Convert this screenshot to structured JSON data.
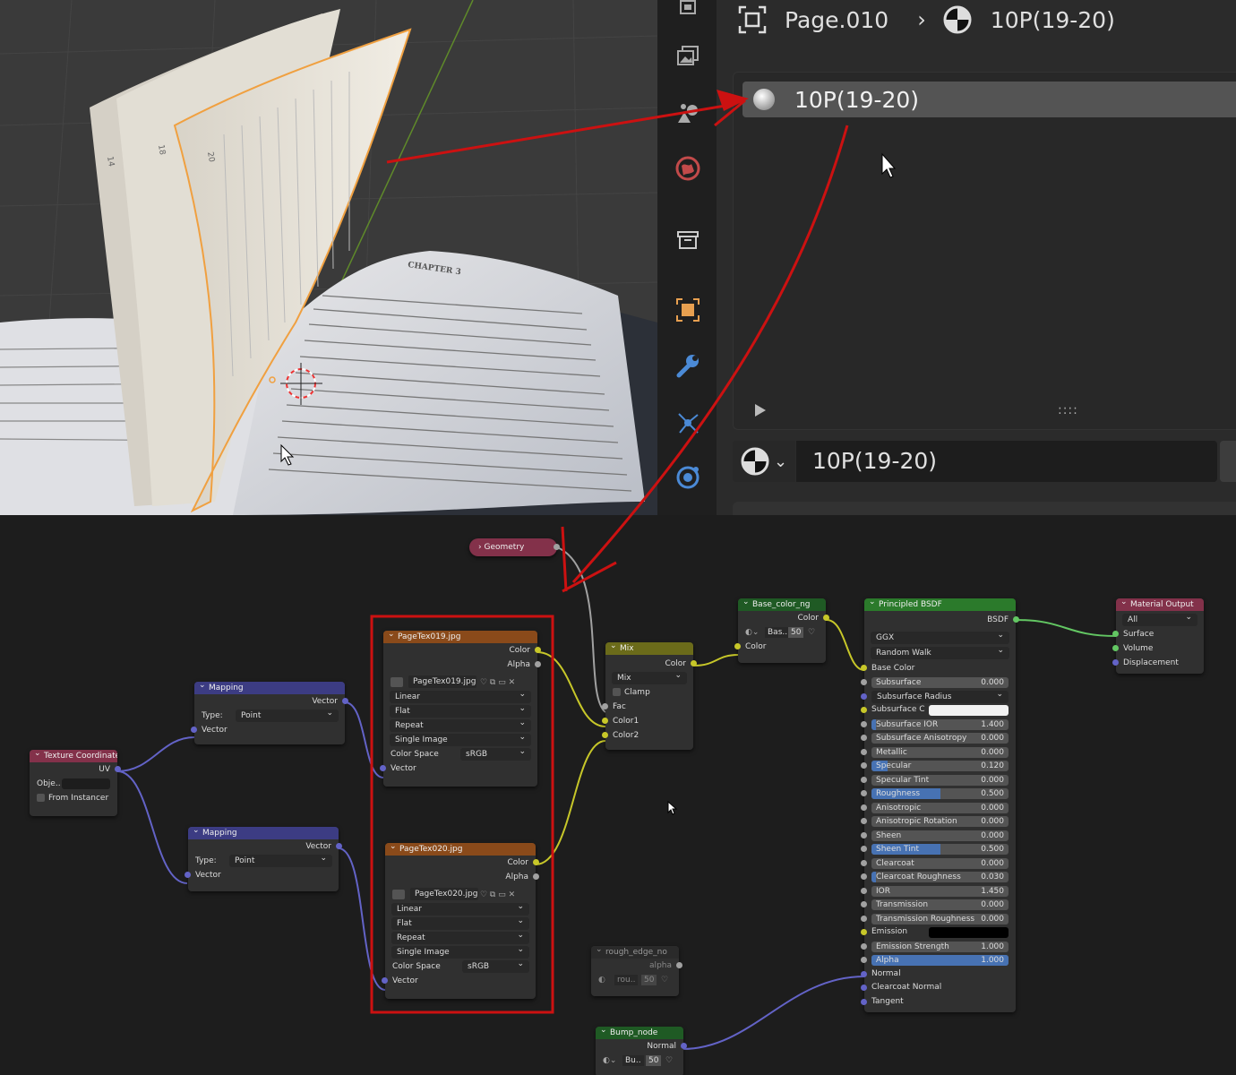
{
  "viewport": {
    "chapter_heading": "CHAPTER 3",
    "page_numbers": [
      "14",
      "18",
      "20"
    ]
  },
  "properties": {
    "breadcrumb": {
      "object": "Page.010",
      "material": "10P(19-20)"
    },
    "material_slot": "10P(19-20)",
    "material_selector": "10P(19-20)"
  },
  "sidebar_tabs": [
    "render-icon",
    "output-icon",
    "view-layer-icon",
    "scene-icon",
    "world-icon",
    "collection-icon",
    "object-icon",
    "modifier-icon",
    "particles-icon",
    "physics-icon"
  ],
  "nodes": {
    "geometry": {
      "title": "Geometry"
    },
    "tex_coord": {
      "title": "Texture Coordinate",
      "uv": "UV",
      "object_label": "Obje..",
      "from_instancer": "From Instancer"
    },
    "mapping1": {
      "title": "Mapping",
      "vector_out": "Vector",
      "type_label": "Type:",
      "type_value": "Point",
      "vector_in": "Vector"
    },
    "mapping2": {
      "title": "Mapping",
      "vector_out": "Vector",
      "type_label": "Type:",
      "type_value": "Point",
      "vector_in": "Vector"
    },
    "tex1": {
      "title": "PageTex019.jpg",
      "color": "Color",
      "alpha": "Alpha",
      "image": "PageTex019.jpg",
      "interp": "Linear",
      "proj": "Flat",
      "ext": "Repeat",
      "source": "Single Image",
      "cs_label": "Color Space",
      "cs_value": "sRGB",
      "vector": "Vector"
    },
    "tex2": {
      "title": "PageTex020.jpg",
      "color": "Color",
      "alpha": "Alpha",
      "image": "PageTex020.jpg",
      "interp": "Linear",
      "proj": "Flat",
      "ext": "Repeat",
      "source": "Single Image",
      "cs_label": "Color Space",
      "cs_value": "sRGB",
      "vector": "Vector"
    },
    "mix": {
      "title": "Mix",
      "color_out": "Color",
      "mode": "Mix",
      "clamp": "Clamp",
      "fac": "Fac",
      "color1": "Color1",
      "color2": "Color2"
    },
    "base_color_ng": {
      "title": "Base_color_ng",
      "color_out": "Color",
      "group": "Bas..",
      "users": "50",
      "color_in": "Color"
    },
    "principled": {
      "title": "Principled BSDF",
      "bsdf": "BSDF",
      "distribution": "GGX",
      "sss_method": "Random Walk",
      "base_color": "Base Color",
      "subsurface_radius": "Subsurface Radius",
      "subsurface_color": "Subsurface C",
      "fields": [
        {
          "label": "Subsurface",
          "value": "0.000",
          "fill": 0
        },
        {
          "label": "Subsurface IOR",
          "value": "1.400",
          "fill": 0.03
        },
        {
          "label": "Subsurface Anisotropy",
          "value": "0.000",
          "fill": 0
        },
        {
          "label": "Metallic",
          "value": "0.000",
          "fill": 0
        },
        {
          "label": "Specular",
          "value": "0.120",
          "fill": 0.12
        },
        {
          "label": "Specular Tint",
          "value": "0.000",
          "fill": 0
        },
        {
          "label": "Roughness",
          "value": "0.500",
          "fill": 0.5
        },
        {
          "label": "Anisotropic",
          "value": "0.000",
          "fill": 0
        },
        {
          "label": "Anisotropic Rotation",
          "value": "0.000",
          "fill": 0
        },
        {
          "label": "Sheen",
          "value": "0.000",
          "fill": 0
        },
        {
          "label": "Sheen Tint",
          "value": "0.500",
          "fill": 0.5
        },
        {
          "label": "Clearcoat",
          "value": "0.000",
          "fill": 0
        },
        {
          "label": "Clearcoat Roughness",
          "value": "0.030",
          "fill": 0.03
        },
        {
          "label": "IOR",
          "value": "1.450",
          "fill": 0
        }
      ],
      "transmission": {
        "label": "Transmission",
        "value": "0.000"
      },
      "transmission_roughness": {
        "label": "Transmission Roughness",
        "value": "0.000"
      },
      "emission": "Emission",
      "emission_strength": {
        "label": "Emission Strength",
        "value": "1.000"
      },
      "alpha": {
        "label": "Alpha",
        "value": "1.000",
        "fill": 1
      },
      "normal": "Normal",
      "clearcoat_normal": "Clearcoat Normal",
      "tangent": "Tangent"
    },
    "material_output": {
      "title": "Material Output",
      "target": "All",
      "surface": "Surface",
      "volume": "Volume",
      "displacement": "Displacement"
    },
    "rough_edge": {
      "title": "rough_edge_no",
      "alpha": "alpha",
      "group": "rou..",
      "users": "50"
    },
    "bump": {
      "title": "Bump_node",
      "normal": "Normal",
      "group": "Bu..",
      "users": "50"
    }
  },
  "colors": {
    "annotation": "#cc1111",
    "selection": "#f0a040",
    "tex_header": "#8a4a1a",
    "vec_header": "#3c3c83",
    "input_header": "#83314a",
    "shader_header": "#2b7a2b",
    "group_header": "#1f5a24",
    "mix_header": "#6b6b1a"
  }
}
